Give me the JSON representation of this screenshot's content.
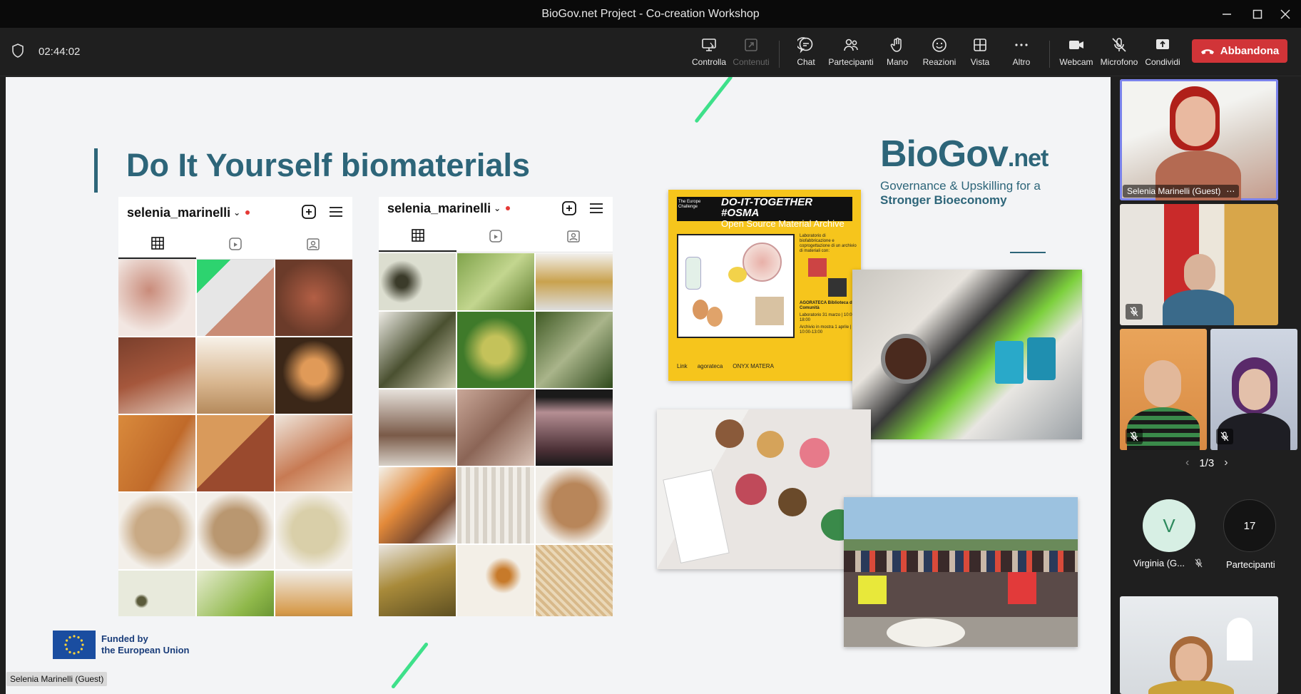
{
  "window": {
    "title": "BioGov.net Project - Co-creation Workshop"
  },
  "toolbar": {
    "timer": "02:44:02",
    "buttons": [
      "Controlla",
      "Contenuti",
      "Chat",
      "Partecipanti",
      "Mano",
      "Reazioni",
      "Vista",
      "Altro",
      "Webcam",
      "Microfono",
      "Condividi"
    ],
    "leave_label": "Abbandona",
    "leave_color": "#d13438"
  },
  "slide": {
    "title": "Do It Yourself biomaterials",
    "logo": {
      "brand": "BioGov",
      "suffix": ".net",
      "line1": "Governance & Upskilling for a",
      "line2": "Stronger Bioeconomy"
    },
    "profiles": [
      {
        "username": "selenia_marinelli"
      },
      {
        "username": "selenia_marinelli"
      }
    ],
    "poster": {
      "title_line1": "DO-IT-TOGETHER #OSMA",
      "title_line2": "Open Source Material Archive",
      "tag": "The Europe Challenge",
      "info": "Laboratorio di biofabbricazione e coprogettazione di un archivio di materiali con:",
      "place": "AGORATECA Biblioteca di Comunità",
      "lab": "Laboratorio 31 marzo | 10:00-18:00",
      "archive": "Archivio in mostra 1 aprile | 10:00-13:00",
      "sponsors": [
        "Link",
        "agorateca",
        "ONYX MATERA"
      ]
    },
    "eu": {
      "line1": "Funded by",
      "line2": "the European Union"
    },
    "accent_color": "#2d6579",
    "deco_color": "#3ee08a"
  },
  "presenter_label": "Selenia Marinelli (Guest)",
  "participants_panel": {
    "active_speaker": "Selenia Marinelli (Guest)",
    "pager": "1/3",
    "avatar_initial": "V",
    "avatar_name": "Virginia (G...",
    "participant_count": "17",
    "participant_label": "Partecipanti"
  }
}
